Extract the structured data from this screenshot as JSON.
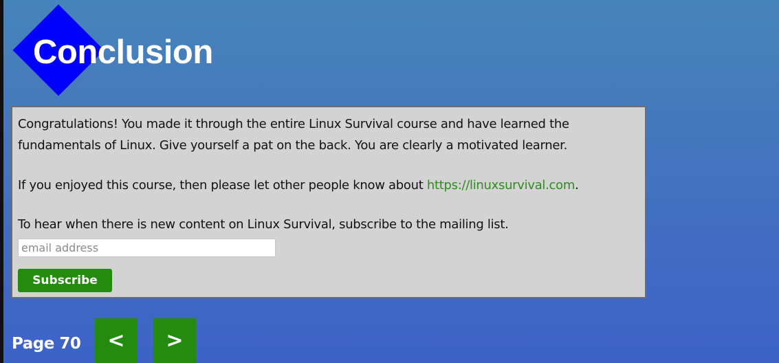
{
  "page": {
    "title": "Conclusion"
  },
  "content": {
    "para1_line1": "Congratulations! You made it through the entire Linux Survival course and have learned the",
    "para1_line2": "fundamentals of Linux. Give yourself a pat on the back. You are clearly a motivated learner.",
    "para2_before": "If you enjoyed this course, then please let other people know about ",
    "para2_link": "https://linuxsurvival.com",
    "para2_after": ".",
    "para3": "To hear when there is new content on Linux Survival, subscribe to the mailing list.",
    "email_placeholder": "email address",
    "email_value": "",
    "subscribe_label": "Subscribe"
  },
  "nav": {
    "page_label": "Page 70",
    "prev_label": "<",
    "next_label": ">"
  },
  "colors": {
    "accent_green": "#238c0e",
    "link_green": "#2e8b1f",
    "title_diamond": "#0000ff",
    "panel_bg": "#d3d3d3"
  },
  "icons": {
    "prev": "chevron-left-icon",
    "next": "chevron-right-icon"
  }
}
